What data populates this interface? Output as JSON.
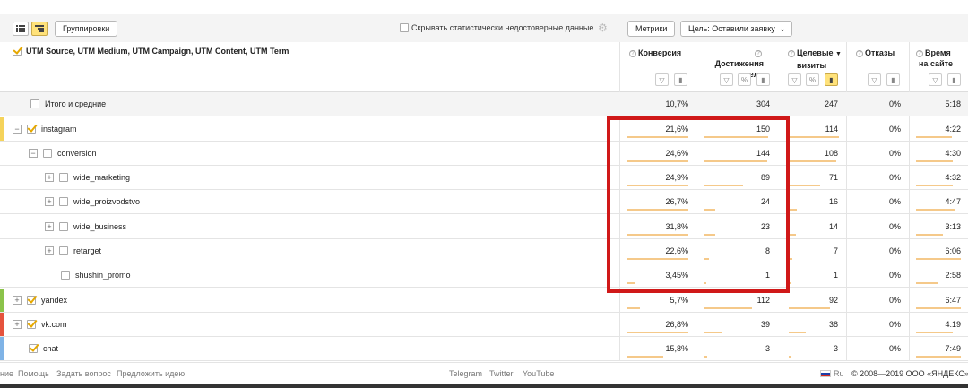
{
  "toolbar": {
    "groupings_label": "Группировки",
    "hide_unreliable_label": "Скрывать статистически недостоверные данные",
    "metrics_label": "Метрики",
    "goal_label": "Цель: Оставили заявку"
  },
  "header": {
    "dimensions_label": "UTM Source, UTM Medium, UTM Campaign, UTM Content, UTM Term",
    "columns": [
      {
        "line1": "Конверсия",
        "line2": ""
      },
      {
        "line1": "Достижения",
        "line2": "цели"
      },
      {
        "line1": "Целевые",
        "line2": "визиты",
        "sort": "▼"
      },
      {
        "line1": "Отказы",
        "line2": ""
      },
      {
        "line1": "Время",
        "line2": "на сайте"
      }
    ]
  },
  "rows": [
    {
      "label": "Итого и средние",
      "conv": "10,7%",
      "goals": "304",
      "visits": "247",
      "bounce": "0%",
      "time": "5:18"
    },
    {
      "label": "instagram",
      "conv": "21,6%",
      "goals": "150",
      "visits": "114",
      "bounce": "0%",
      "time": "4:22"
    },
    {
      "label": "conversion",
      "conv": "24,6%",
      "goals": "144",
      "visits": "108",
      "bounce": "0%",
      "time": "4:30"
    },
    {
      "label": "wide_marketing",
      "conv": "24,9%",
      "goals": "89",
      "visits": "71",
      "bounce": "0%",
      "time": "4:32"
    },
    {
      "label": "wide_proizvodstvo",
      "conv": "26,7%",
      "goals": "24",
      "visits": "16",
      "bounce": "0%",
      "time": "4:47"
    },
    {
      "label": "wide_business",
      "conv": "31,8%",
      "goals": "23",
      "visits": "14",
      "bounce": "0%",
      "time": "3:13"
    },
    {
      "label": "retarget",
      "conv": "22,6%",
      "goals": "8",
      "visits": "7",
      "bounce": "0%",
      "time": "6:06"
    },
    {
      "label": "shushin_promo",
      "conv": "3,45%",
      "goals": "1",
      "visits": "1",
      "bounce": "0%",
      "time": "2:58"
    },
    {
      "label": "yandex",
      "conv": "5,7%",
      "goals": "112",
      "visits": "92",
      "bounce": "0%",
      "time": "6:47"
    },
    {
      "label": "vk.com",
      "conv": "26,8%",
      "goals": "39",
      "visits": "38",
      "bounce": "0%",
      "time": "4:19"
    },
    {
      "label": "chat",
      "conv": "15,8%",
      "goals": "3",
      "visits": "3",
      "bounce": "0%",
      "time": "7:49"
    }
  ],
  "footer": {
    "links": [
      "ние",
      "Помощь",
      "Задать вопрос",
      "Предложить идею"
    ],
    "social": [
      "Telegram",
      "Twitter",
      "YouTube"
    ],
    "lang": "Ru",
    "copyright": "© 2008—2019 ООО «ЯНДЕКС»"
  },
  "colors": {
    "accent": "#ffe27a",
    "highlight_box": "#d01818",
    "bar": "#f5c98a",
    "instagram": "#f5d35b",
    "yandex": "#8bc34a",
    "vk": "#e5533d",
    "chat": "#7fb3e6"
  }
}
